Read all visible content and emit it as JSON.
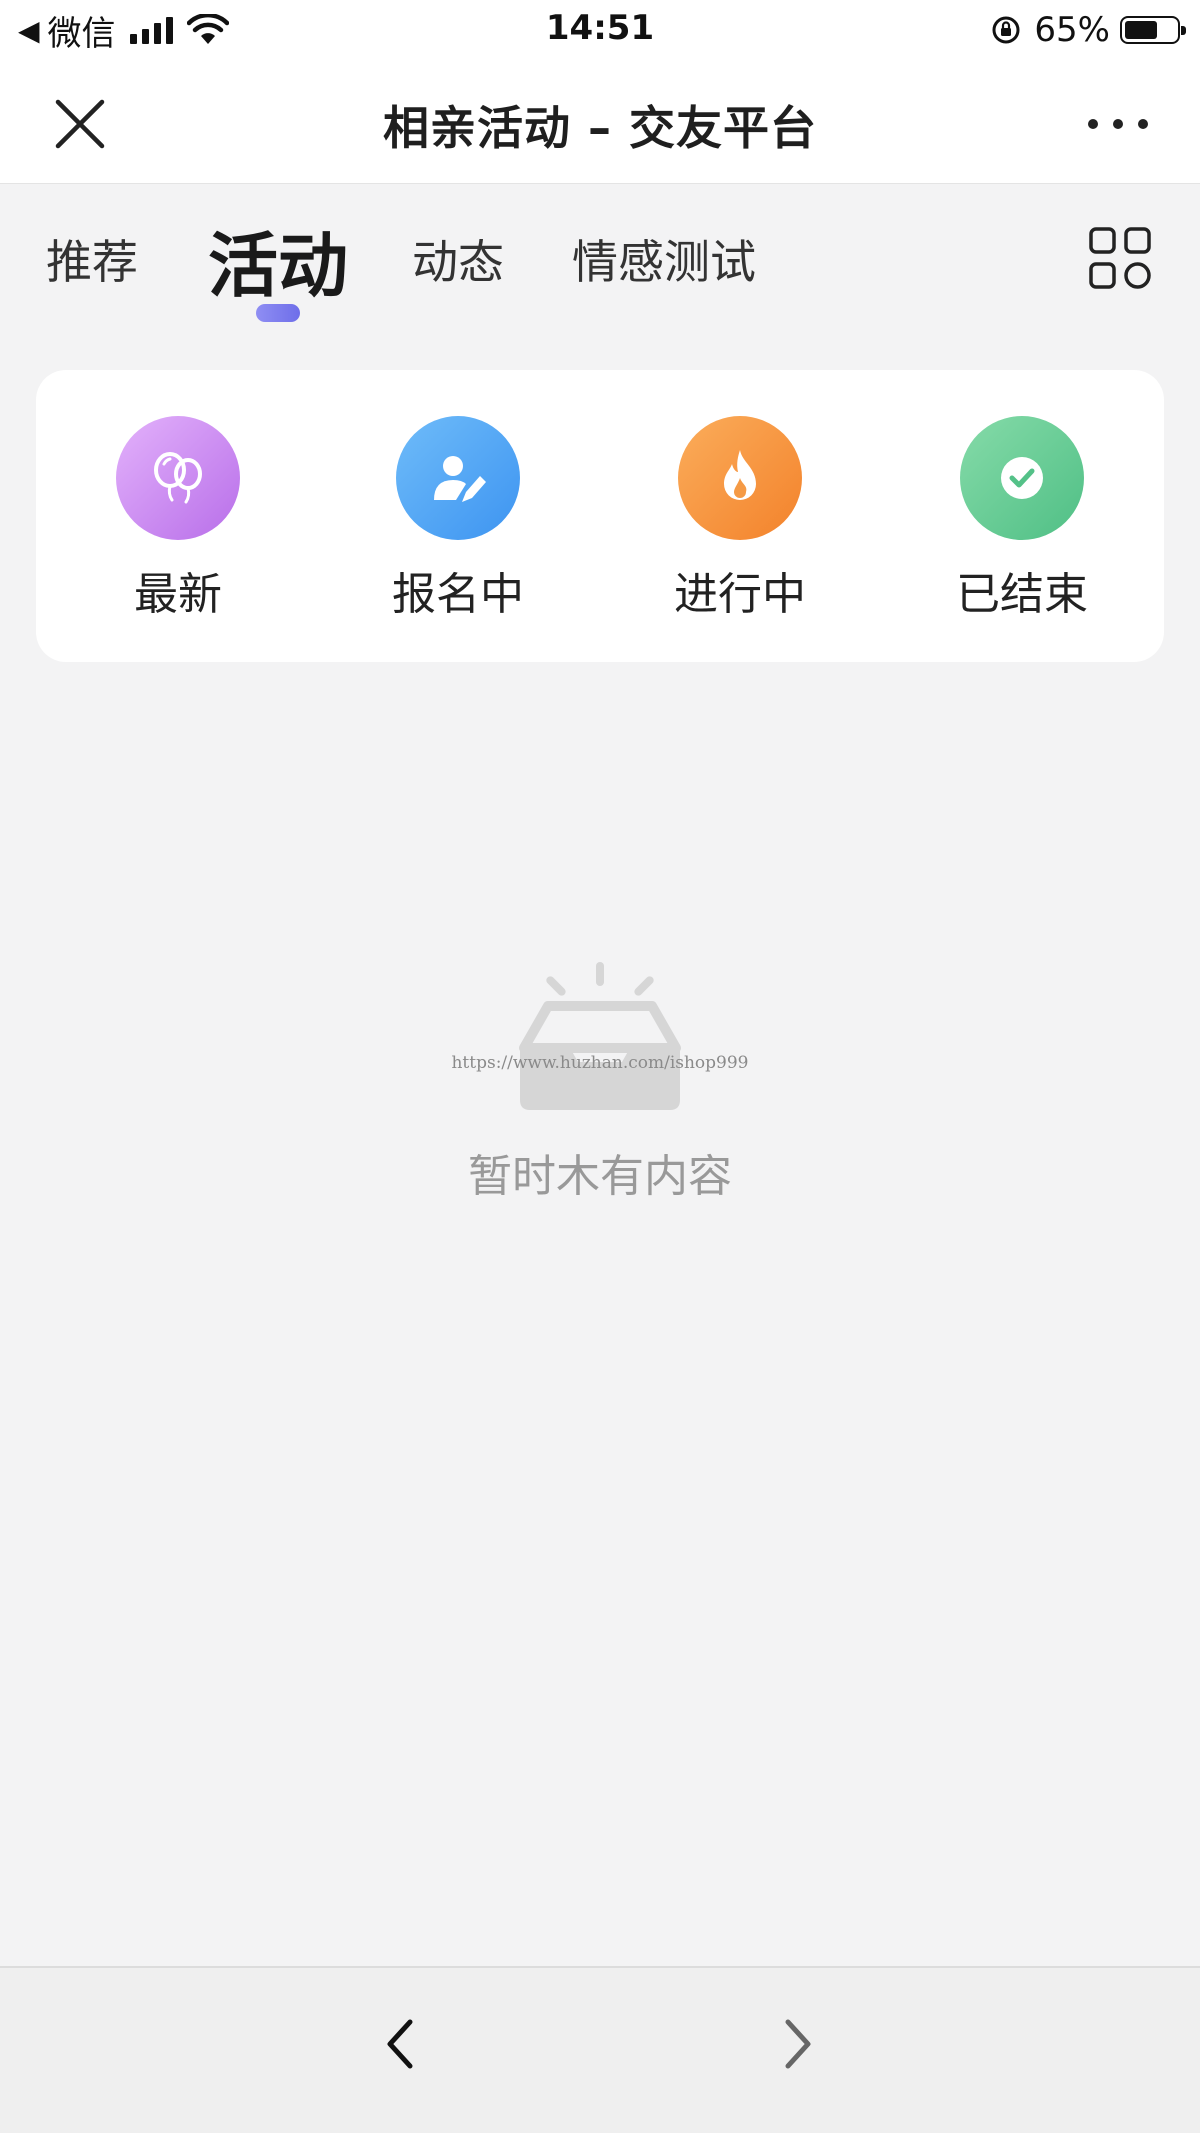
{
  "status_bar": {
    "back_app": "微信",
    "time": "14:51",
    "battery_percent": "65%",
    "battery_level": 0.65
  },
  "nav": {
    "title": "相亲活动 – 交友平台"
  },
  "tabs": [
    {
      "label": "推荐",
      "active": false
    },
    {
      "label": "活动",
      "active": true
    },
    {
      "label": "动态",
      "active": false
    },
    {
      "label": "情感测试",
      "active": false
    }
  ],
  "categories": [
    {
      "label": "最新",
      "icon": "balloons-icon",
      "color": "#c47ff0"
    },
    {
      "label": "报名中",
      "icon": "signup-pen-icon",
      "color": "#4aa3f5"
    },
    {
      "label": "进行中",
      "icon": "fire-icon",
      "color": "#f5913a"
    },
    {
      "label": "已结束",
      "icon": "check-icon",
      "color": "#5cc490"
    }
  ],
  "empty_state": {
    "watermark": "https://www.huzhan.com/ishop999",
    "message": "暂时木有内容"
  },
  "colors": {
    "tab_indicator": "#7f7ef0",
    "background": "#f3f3f4"
  }
}
